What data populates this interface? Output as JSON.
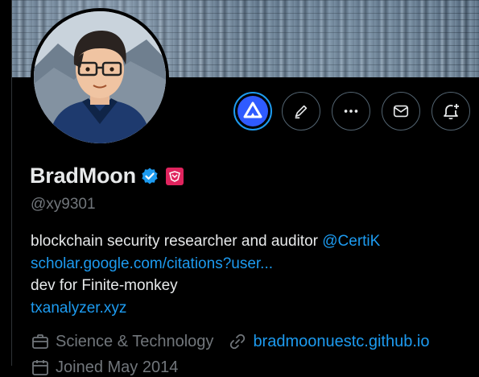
{
  "profile": {
    "name": "BradMoon",
    "handle": "@xy9301",
    "bio_line1_text": "blockchain security researcher and auditor ",
    "bio_line1_mention": "@CertiK",
    "bio_line2_link": "scholar.google.com/citations?user...",
    "bio_line3": "dev for Finite-monkey",
    "bio_line4_link": "txanalyzer.xyz"
  },
  "meta": {
    "category": "Science & Technology",
    "website": "bradmoonuestc.github.io",
    "joined": "Joined May 2014"
  },
  "icons": {
    "action1": "project-logo-icon",
    "action2": "edit-pen-icon",
    "action3": "more-icon",
    "action4": "message-icon",
    "action5": "notification-bell-plus-icon"
  },
  "colors": {
    "accent": "#1d9bf0",
    "muted": "#71767b",
    "text": "#e7e9ea",
    "affiliate_badge": "#e0245e"
  }
}
